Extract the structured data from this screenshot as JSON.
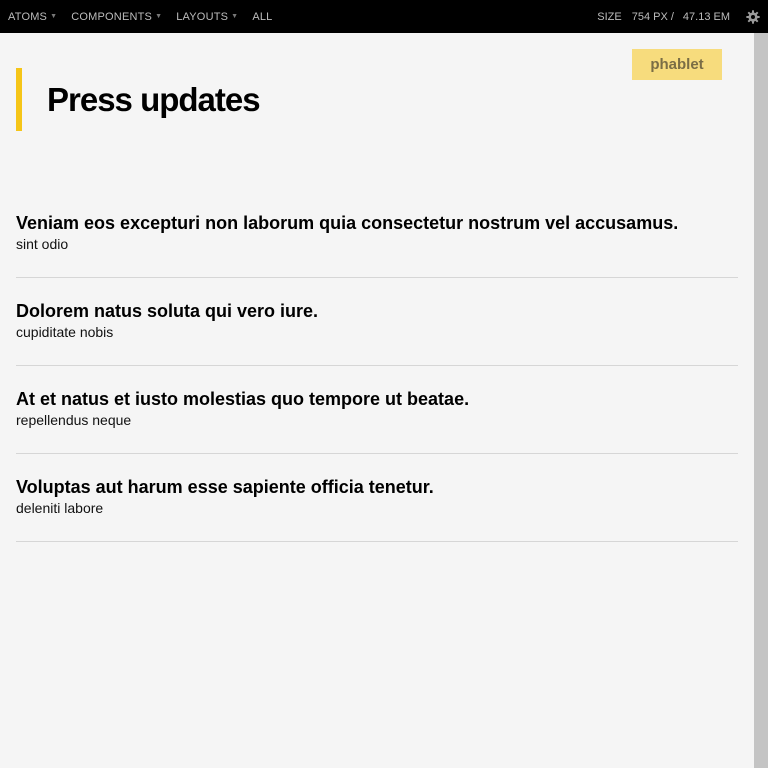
{
  "toolbar": {
    "nav": [
      {
        "label": "ATOMS",
        "has_caret": true
      },
      {
        "label": "COMPONENTS",
        "has_caret": true
      },
      {
        "label": "LAYOUTS",
        "has_caret": true
      },
      {
        "label": "ALL",
        "has_caret": false
      }
    ],
    "size_label": "SIZE",
    "size_px": "754 PX /",
    "size_em": "47.13 EM",
    "settings_icon": "gear-icon"
  },
  "badge": {
    "label": "phablet"
  },
  "page": {
    "title": "Press updates"
  },
  "items": [
    {
      "title": "Veniam eos excepturi non laborum quia consectetur nostrum vel accusamus.",
      "subtitle": "sint odio"
    },
    {
      "title": "Dolorem natus soluta qui vero iure.",
      "subtitle": "cupiditate nobis"
    },
    {
      "title": "At et natus et iusto molestias quo tempore ut beatae.",
      "subtitle": "repellendus neque"
    },
    {
      "title": "Voluptas aut harum esse sapiente officia tenetur.",
      "subtitle": "deleniti labore"
    }
  ],
  "colors": {
    "toolbar_bg": "#000000",
    "accent_bar": "#f5c518",
    "badge_bg": "#f7dc7d",
    "page_bg": "#f5f5f5",
    "scrollbar": "#c4c4c4"
  }
}
